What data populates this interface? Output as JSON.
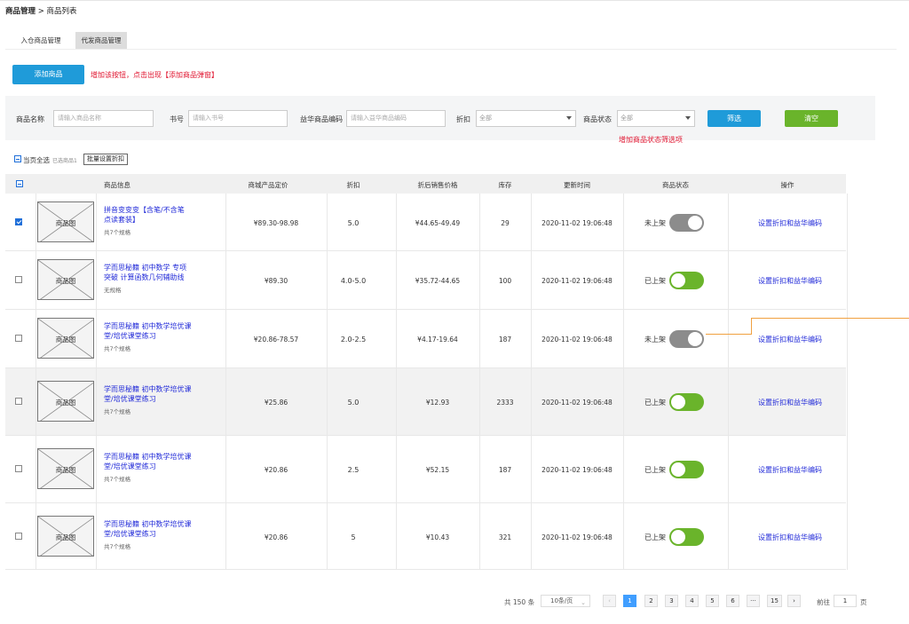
{
  "breadcrumb": {
    "root": "商品管理",
    "sep": " > ",
    "current": "商品列表"
  },
  "tabs": [
    {
      "label": "入仓商品管理"
    },
    {
      "label": "代发商品管理"
    }
  ],
  "actions": {
    "add_label": "添加商品",
    "add_note": "增加该按钮，点击出现【添加商品弹窗】"
  },
  "filters": {
    "name_label": "商品名称",
    "name_placeholder": "请输入商品名称",
    "book_label": "书号",
    "book_placeholder": "请输入书号",
    "code_label": "益华商品编码",
    "code_placeholder": "请输入益华商品编码",
    "discount_label": "折扣",
    "discount_value": "全部",
    "status_label": "商品状态",
    "status_value": "全部",
    "status_note": "增加商品状态筛选项",
    "filter_btn": "筛选",
    "clear_btn": "清空"
  },
  "selection": {
    "select_all": "当页全选",
    "selected_info": "已选商品1",
    "batch_btn": "批量设置折扣"
  },
  "table": {
    "headers": [
      "商品信息",
      "商城产品定价",
      "折扣",
      "折后销售价格",
      "库存",
      "更新时间",
      "商品状态",
      "操作"
    ],
    "image_placeholder": "商品图",
    "action_label": "设置折扣和益华编码",
    "rows": [
      {
        "checked": true,
        "name_l1": "拼音变变变【含笔/不含笔",
        "name_l2": "点读套装】",
        "spec": "共7个规格",
        "price": "¥89.30-98.98",
        "discount": "5.0",
        "sale": "¥44.65-49.49",
        "stock": "29",
        "time": "2020-11-02 19:06:48",
        "status": "未上架",
        "on": false
      },
      {
        "checked": false,
        "name_l1": "学而思秘籍 初中数学 专项",
        "name_l2": "突破 计算函数几何辅助线",
        "spec": "无规格",
        "price": "¥89.30",
        "discount": "4.0-5.0",
        "sale": "¥35.72-44.65",
        "stock": "100",
        "time": "2020-11-02 19:06:48",
        "status": "已上架",
        "on": true
      },
      {
        "checked": false,
        "name_l1": "学而思秘籍 初中数学培优课",
        "name_l2": "堂/培优课堂练习",
        "spec": "共7个规格",
        "price": "¥20.86-78.57",
        "discount": "2.0-2.5",
        "sale": "¥4.17-19.64",
        "stock": "187",
        "time": "2020-11-02 19:06:48",
        "status": "未上架",
        "on": false
      },
      {
        "checked": false,
        "name_l1": "学而思秘籍 初中数学培优课",
        "name_l2": "堂/培优课堂练习",
        "spec": "共7个规格",
        "price": "¥25.86",
        "discount": "5.0",
        "sale": "¥12.93",
        "stock": "2333",
        "time": "2020-11-02 19:06:48",
        "status": "已上架",
        "on": true
      },
      {
        "checked": false,
        "name_l1": "学而思秘籍 初中数学培优课",
        "name_l2": "堂/培优课堂练习",
        "spec": "共7个规格",
        "price": "¥20.86",
        "discount": "2.5",
        "sale": "¥52.15",
        "stock": "187",
        "time": "2020-11-02 19:06:48",
        "status": "已上架",
        "on": true
      },
      {
        "checked": false,
        "name_l1": "学而思秘籍 初中数学培优课",
        "name_l2": "堂/培优课堂练习",
        "spec": "共7个规格",
        "price": "¥20.86",
        "discount": "5",
        "sale": "¥10.43",
        "stock": "321",
        "time": "2020-11-02 19:06:48",
        "status": "已上架",
        "on": true
      }
    ]
  },
  "pagination": {
    "total": "共 150 条",
    "page_size": "10条/页",
    "prev": "‹",
    "next": "›",
    "pages": [
      "1",
      "2",
      "3",
      "4",
      "5",
      "6",
      "···",
      "15"
    ],
    "goto_label": "前往",
    "goto_value": "1",
    "goto_unit": "页"
  },
  "colors": {
    "primary": "#1f9bd9",
    "success": "#6ab42b",
    "link": "#2029d8",
    "danger": "#e0142f",
    "toggle_off": "#8c8c8c"
  }
}
